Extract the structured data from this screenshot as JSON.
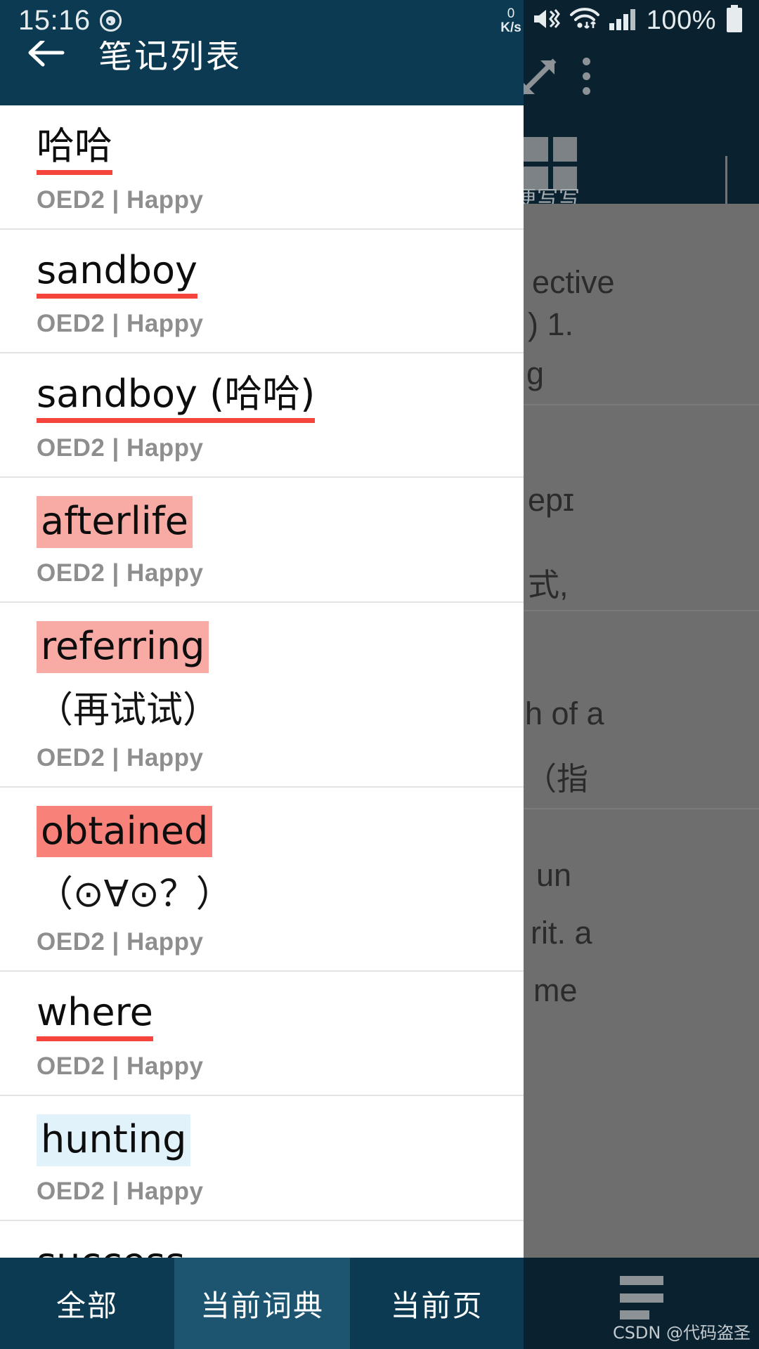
{
  "status_bar": {
    "time": "15:16",
    "alarm_icon": "alarm-eye-icon",
    "net_speed_value": "0",
    "net_speed_unit": "K/s",
    "mute_icon": "mute-vibrate-icon",
    "wifi_icon": "wifi-icon",
    "signal_icon": "signal-bars-icon",
    "battery_text": "100%",
    "battery_icon": "battery-full-icon"
  },
  "app_bar": {
    "back_icon": "back-arrow-icon",
    "title": "笔记列表"
  },
  "notes": [
    {
      "title": "哈哈",
      "style": "u-red",
      "cn": "",
      "meta": "OED2 | Happy"
    },
    {
      "title": "sandboy",
      "style": "u-red",
      "cn": "",
      "meta": "OED2 | Happy"
    },
    {
      "title": "sandboy (哈哈)",
      "style": "u-red",
      "cn": "",
      "meta": "OED2 | Happy"
    },
    {
      "title": "afterlife",
      "style": "hl-pink",
      "cn": "",
      "meta": "OED2 | Happy"
    },
    {
      "title": "referring",
      "style": "hl-pink",
      "cn": "（再试试）",
      "meta": "OED2 | Happy"
    },
    {
      "title": "obtained",
      "style": "hl-coral",
      "cn": "（⊙∀⊙？）",
      "meta": "OED2 | Happy"
    },
    {
      "title": "where",
      "style": "u-red",
      "cn": "",
      "meta": "OED2 | Happy"
    },
    {
      "title": "hunting",
      "style": "hl-blue",
      "cn": "",
      "meta": "OED2 | Happy"
    },
    {
      "title": "success",
      "style": "plain",
      "cn": "",
      "meta": ""
    }
  ],
  "bottom_tabs": {
    "all_label": "全部",
    "current_dict_label": "当前词典",
    "current_page_label": "当前页",
    "menu_icon": "hamburger-menu-icon",
    "selected": "当前词典"
  },
  "background_app": {
    "resize_icon": "resize-diagonal-arrows-icon",
    "overflow_icon": "kebab-menu-icon",
    "grid_icon": "grid-four-squares-icon",
    "grid_label": "便写写",
    "content_lines": [
      "ective",
      ") 1.",
      "g",
      "epɪ",
      "式,",
      "h of a",
      "（指",
      "un",
      "rit. a",
      "me"
    ]
  },
  "watermark": "CSDN @代码盗圣",
  "colors": {
    "appbar": "#0b3a52",
    "tab_selected": "#1d5571",
    "dark_panel": "#0a2230",
    "underline_red": "#f4443c",
    "highlight_pink": "#f8aaa4",
    "highlight_coral": "#f8827a",
    "highlight_blue": "#e2f2fa",
    "meta_gray": "#8e8e8e"
  }
}
